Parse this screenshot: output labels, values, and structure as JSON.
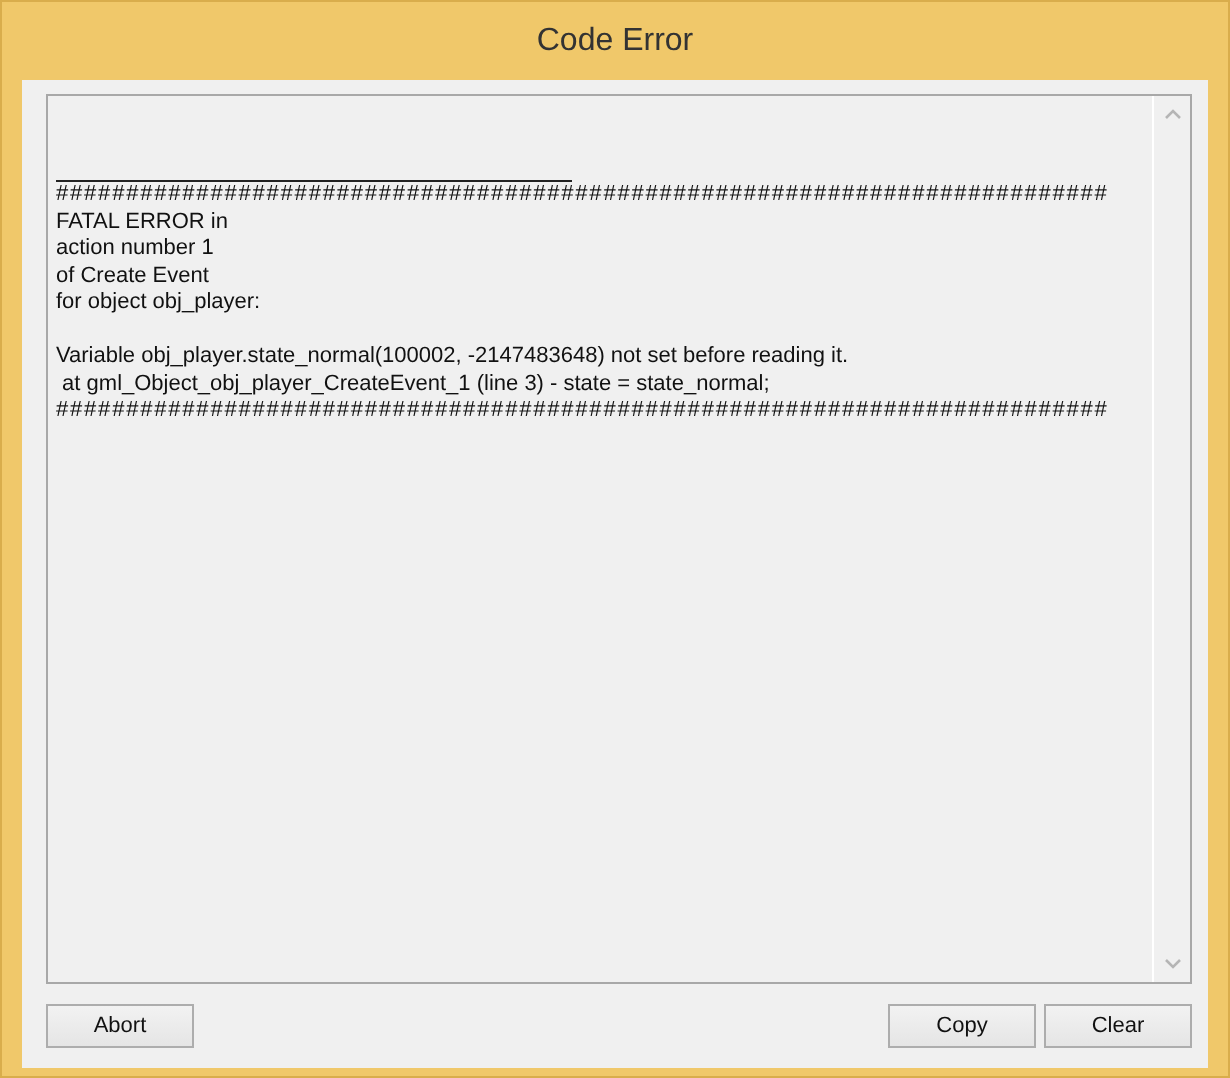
{
  "window": {
    "title": "Code Error"
  },
  "log": {
    "lines": [
      {
        "kind": "blank"
      },
      {
        "kind": "rule"
      },
      {
        "kind": "hashes",
        "text": "###########################################################################"
      },
      {
        "kind": "text",
        "text": "FATAL ERROR in"
      },
      {
        "kind": "text",
        "text": "action number 1"
      },
      {
        "kind": "text",
        "text": "of Create Event"
      },
      {
        "kind": "text",
        "text": "for object obj_player:"
      },
      {
        "kind": "blank"
      },
      {
        "kind": "text",
        "text": "Variable obj_player.state_normal(100002, -2147483648) not set before reading it."
      },
      {
        "kind": "text",
        "text": " at gml_Object_obj_player_CreateEvent_1 (line 3) - state = state_normal;"
      },
      {
        "kind": "hashes",
        "text": "###########################################################################"
      }
    ]
  },
  "buttons": {
    "left": [
      "Abort"
    ],
    "right": [
      "Copy",
      "Clear"
    ]
  }
}
